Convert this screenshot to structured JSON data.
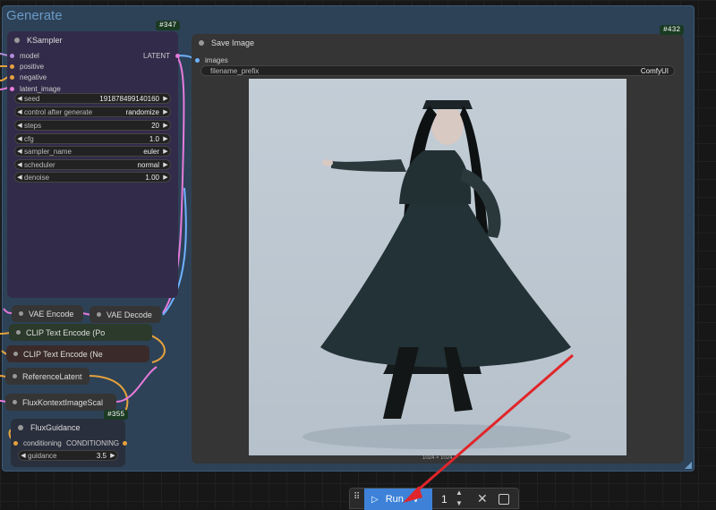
{
  "group": {
    "title": "Generate"
  },
  "ksampler": {
    "title": "KSampler",
    "badge": "#347",
    "inputs": [
      "model",
      "positive",
      "negative",
      "latent_image"
    ],
    "output": "LATENT",
    "widgets": [
      {
        "label": "seed",
        "value": "191878499140160"
      },
      {
        "label": "control after generate",
        "value": "randomize"
      },
      {
        "label": "steps",
        "value": "20"
      },
      {
        "label": "cfg",
        "value": "1.0"
      },
      {
        "label": "sampler_name",
        "value": "euler"
      },
      {
        "label": "scheduler",
        "value": "normal"
      },
      {
        "label": "denoise",
        "value": "1.00"
      }
    ]
  },
  "save_image": {
    "title": "Save Image",
    "badge": "#432",
    "input": "images",
    "prefix_label": "filename_prefix",
    "prefix_value": "ComfyUI",
    "dimensions": "1024 × 1024"
  },
  "mini_nodes": {
    "vae_encode": "VAE Encode",
    "vae_decode": "VAE Decode",
    "clip_pos": "CLIP Text Encode (Po",
    "clip_neg": "CLIP Text Encode (Ne",
    "reference_latent": "ReferenceLatent",
    "flux_kontext": "FluxKontextImageScal"
  },
  "flux_guidance": {
    "title": "FluxGuidance",
    "badge": "#355",
    "input": "conditioning",
    "output": "CONDITIONING",
    "widget_label": "guidance",
    "widget_value": "3.5"
  },
  "toolbar": {
    "run_label": "Run",
    "batch_count": "1"
  },
  "colors": {
    "group_bg": "#2d4257",
    "ksampler_bg": "#332b4a",
    "run_button": "#3d82d8",
    "annotation_arrow": "#e0262a"
  }
}
